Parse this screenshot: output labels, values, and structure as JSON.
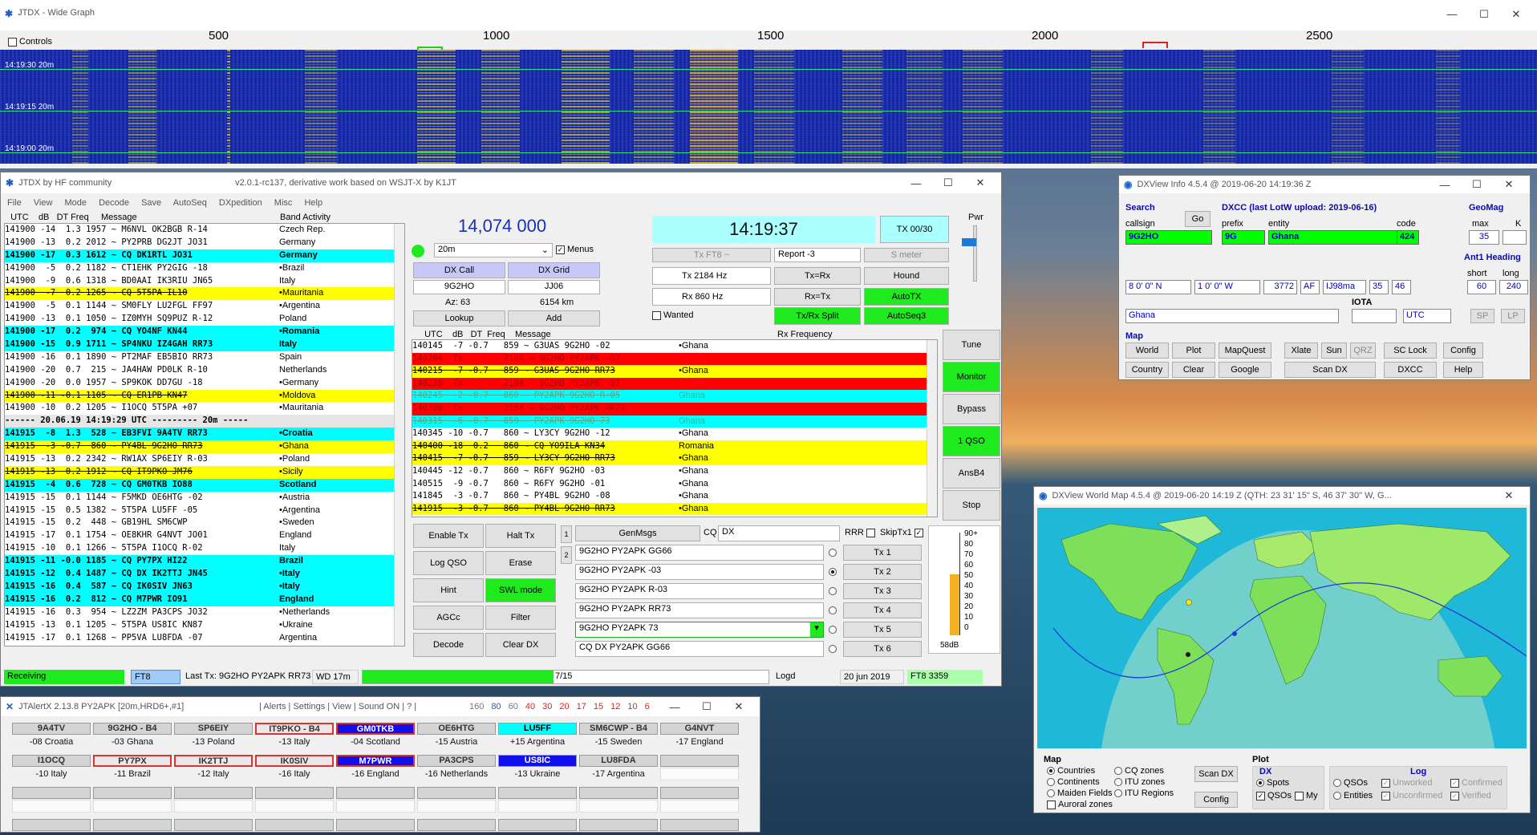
{
  "wide_graph": {
    "title": "JTDX - Wide Graph",
    "controls_label": "Controls",
    "scale_labels": [
      "500",
      "1000",
      "1500",
      "2000",
      "2500"
    ],
    "time_labels": [
      "14:19:30  20m",
      "14:19:15  20m",
      "14:19:00  20m"
    ],
    "colors": {
      "background": "#1a2fb8",
      "signal": "#ffe600",
      "timeline": "#2ee08a"
    }
  },
  "jtdx": {
    "title": "JTDX  by HF community",
    "subtitle": "v2.0.1-rc137, derivative work based on WSJT-X by K1JT",
    "menu": [
      "File",
      "View",
      "Mode",
      "Decode",
      "Save",
      "AutoSeq",
      "DXpedition",
      "Misc",
      "Help"
    ],
    "band_activity": {
      "header": "  UTC    dB   DT Freq     Message",
      "title": "Band Activity",
      "rows": [
        {
          "t": "141900 -14  1.3 1957 ~ M6NVL OK2BGB R-14",
          "c": "Czech Rep.",
          "s": ""
        },
        {
          "t": "141900 -13  0.2 2012 ~ PY2PRB DG2JT JO31",
          "c": "Germany",
          "s": ""
        },
        {
          "t": "141900 -17  0.3 1612 ~ CQ DK1RTL JO31",
          "c": "Germany",
          "s": "cq"
        },
        {
          "t": "141900  -5  0.2 1182 ~ CT1EHK PY2GIG -18",
          "c": "•Brazil",
          "s": ""
        },
        {
          "t": "141900  -9  0.6 1318 ~ BD0AAI IK3RIU JN65",
          "c": "Italy",
          "s": ""
        },
        {
          "t": "141900  -7  0.2 1265 ~ CQ 5T5PA IL10",
          "c": "•Mauritania",
          "s": "wk"
        },
        {
          "t": "141900  -5  0.1 1144 ~ SM0FLY LU2FGL FF97",
          "c": "•Argentina",
          "s": ""
        },
        {
          "t": "141900 -13  0.1 1050 ~ IZ0MYH SQ9PUZ R-12",
          "c": "Poland",
          "s": ""
        },
        {
          "t": "141900 -17  0.2  974 ~ CQ YO4NF KN44",
          "c": "•Romania",
          "s": "cq"
        },
        {
          "t": "141900 -15  0.9 1711 ~ SP4NKU IZ4GAH RR73",
          "c": "Italy",
          "s": "cq"
        },
        {
          "t": "141900 -16  0.1 1890 ~ PT2MAF EB5BIO RR73",
          "c": "Spain",
          "s": ""
        },
        {
          "t": "141900 -20  0.7  215 ~ JA4HAW PD0LK R-10",
          "c": "Netherlands",
          "s": ""
        },
        {
          "t": "141900 -20  0.0 1957 ~ SP9KOK DD7GU -18",
          "c": "•Germany",
          "s": ""
        },
        {
          "t": "141900 -11 -0.1 1105 ~ CQ ER1PB KN47",
          "c": "•Moldova",
          "s": "wk"
        },
        {
          "t": "141900 -10  0.2 1205 ~ I1OCQ 5T5PA +07",
          "c": "•Mauritania",
          "s": ""
        },
        {
          "t": "------ 20.06.19 14:19:29 UTC --------- 20m -----",
          "c": "",
          "s": "sep"
        },
        {
          "t": "141915  -8  1.3  528 ~ EB3FVI 9A4TV RR73",
          "c": "•Croatia",
          "s": "cq"
        },
        {
          "t": "141915  -3 -0.7  860 ~ PY4BL 9G2HO RR73",
          "c": "•Ghana",
          "s": "wk"
        },
        {
          "t": "141915 -13  0.2 2342 ~ RW1AX SP6EIY R-03",
          "c": "•Poland",
          "s": ""
        },
        {
          "t": "141915 -13  0.2 1912 ~ CQ IT9PKO JM76",
          "c": "•Sicily",
          "s": "wk"
        },
        {
          "t": "141915  -4  0.6  728 ~ CQ GM0TKB IO88",
          "c": "Scotland",
          "s": "cq"
        },
        {
          "t": "141915 -15  0.1 1144 ~ F5MKD OE6HTG -02",
          "c": "•Austria",
          "s": ""
        },
        {
          "t": "141915 -15  0.5 1382 ~ 5T5PA LU5FF -05",
          "c": "•Argentina",
          "s": ""
        },
        {
          "t": "141915 -15  0.2  448 ~ GB19HL SM6CWP",
          "c": "•Sweden",
          "s": ""
        },
        {
          "t": "141915 -17  0.1 1754 ~ OE8KHR G4NVT JO01",
          "c": "England",
          "s": ""
        },
        {
          "t": "141915 -10  0.1 1266 ~ 5T5PA I1OCQ R-02",
          "c": "Italy",
          "s": ""
        },
        {
          "t": "141915 -11 -0.0 1185 ~ CQ PY7PX HI22",
          "c": "Brazil",
          "s": "cq"
        },
        {
          "t": "141915 -12  0.4 1487 ~ CQ DX IK2TTJ JN45",
          "c": "•Italy",
          "s": "cq"
        },
        {
          "t": "141915 -16  0.4  587 ~ CQ IK0SIV JN63",
          "c": "•Italy",
          "s": "cq"
        },
        {
          "t": "141915 -16  0.2  812 ~ CQ M7PWR IO91",
          "c": "England",
          "s": "cq"
        },
        {
          "t": "141915 -16  0.3  954 ~ LZ2ZM PA3CPS JO32",
          "c": "•Netherlands",
          "s": ""
        },
        {
          "t": "141915 -13  0.1 1205 ~ 5T5PA US8IC KN87",
          "c": "•Ukraine",
          "s": ""
        },
        {
          "t": "141915 -17  0.1 1268 ~ PP5VA LU8FDA -07",
          "c": "Argentina",
          "s": ""
        }
      ]
    },
    "rx_frequency": {
      "header": "  UTC    dB   DT  Freq    Message",
      "title": "Rx Frequency",
      "rows": [
        {
          "t": "140145  -7 -0.7   859 ~ G3UAS 9G2HO -02",
          "c": "•Ghana",
          "s": ""
        },
        {
          "t": "140204  Tx        2184 ~ 9G2HO PY2APK -07",
          "c": "",
          "s": "tx"
        },
        {
          "t": "140215  -7 -0.7   859 ~ G3UAS 9G2HO RR73",
          "c": "•Ghana",
          "s": "wk"
        },
        {
          "t": "140230  Tx        2184 ~ 9G2HO PY2APK -07",
          "c": "",
          "s": "tx"
        },
        {
          "t": "140245  -2 -0.7   860 ~ PY2APK 9G2HO R-05",
          "c": "Ghana",
          "s": "cy"
        },
        {
          "t": "140300  Tx        2184 ~ 9G2HO PY2APK RR73",
          "c": "",
          "s": "tx"
        },
        {
          "t": "140315  -6 -0.7   859 ~ PY2APK 9G2HO 73",
          "c": "Ghana",
          "s": "cy"
        },
        {
          "t": "140345 -10 -0.7   860 ~ LY3CY 9G2HO -12",
          "c": "•Ghana",
          "s": ""
        },
        {
          "t": "140400 -18  0.2   860 ~ CQ YO9ILA KN34",
          "c": "Romania",
          "s": "wk"
        },
        {
          "t": "140415  -7 -0.7   859 ~ LY3CY 9G2HO RR73",
          "c": "•Ghana",
          "s": "wk"
        },
        {
          "t": "140445 -12 -0.7   860 ~ R6FY 9G2HO -03",
          "c": "•Ghana",
          "s": ""
        },
        {
          "t": "140515  -9 -0.7   860 ~ R6FY 9G2HO -01",
          "c": "•Ghana",
          "s": ""
        },
        {
          "t": "141845  -3 -0.7   860 ~ PY4BL 9G2HO -08",
          "c": "•Ghana",
          "s": ""
        },
        {
          "t": "141915  -3 -0.7   860 ~ PY4BL 9G2HO RR73",
          "c": "•Ghana",
          "s": "wk"
        }
      ]
    },
    "frequency": "14,074 000",
    "band": "20m",
    "menus_label": "Menus",
    "dx_call_label": "DX Call",
    "dx_grid_label": "DX Grid",
    "dx_call": "9G2HO",
    "dx_grid": "JJ06",
    "az": "Az: 63",
    "distance": "6154 km",
    "lookup": "Lookup",
    "add": "Add",
    "clock": "14:19:37",
    "tx_counter": "TX 00/30",
    "tx_mode": "Tx FT8 ~",
    "report": "Report -3",
    "s_meter": "S meter",
    "tx_freq": "Tx  2184 Hz",
    "rx_freq": "Rx  860 Hz",
    "txeqrx": "Tx=Rx",
    "rxeqtx": "Rx=Tx",
    "hound": "Hound",
    "autotx": "AutoTX",
    "txrx_split": "Tx/Rx Split",
    "autoseq3": "AutoSeq3",
    "wanted": "Wanted",
    "pwr": "Pwr",
    "side_buttons": [
      "Tune",
      "Monitor",
      "Bypass",
      "1 QSO",
      "AnsB4",
      "Stop"
    ],
    "left_buttons": [
      [
        "Enable Tx",
        "Halt Tx"
      ],
      [
        "Log QSO",
        "Erase"
      ],
      [
        "Hint",
        "SWL mode"
      ],
      [
        "AGCc",
        "Filter"
      ],
      [
        "Decode",
        "Clear DX"
      ]
    ],
    "tab_labels": [
      "1",
      "2"
    ],
    "genmsgs": "GenMsgs",
    "cq_label": "CQ",
    "cq_value": "DX",
    "rrr": "RRR",
    "skiptx1": "SkipTx1",
    "messages": [
      "9G2HO PY2APK GG66",
      "9G2HO PY2APK -03",
      "9G2HO PY2APK R-03",
      "9G2HO PY2APK RR73",
      "9G2HO PY2APK 73",
      "CQ DX PY2APK GG66"
    ],
    "tx_buttons": [
      "Tx 1",
      "Tx 2",
      "Tx 3",
      "Tx 4",
      "Tx 5",
      "Tx 6"
    ],
    "meter_labels": [
      "90+",
      "80",
      "70",
      "60",
      "50",
      "40",
      "30",
      "20",
      "10",
      "0"
    ],
    "meter_value": "58dB",
    "meter_level_db": 58,
    "status": {
      "receiving": "Receiving",
      "mode": "FT8",
      "last_tx": "Last Tx: 9G2HO PY2APK RR73",
      "wd": "WD 17m",
      "progress": "7/15",
      "progress_fraction": 0.47,
      "logd": "Logd",
      "date": "20 jun 2019",
      "ft8": "FT8  3359"
    }
  },
  "dxview_info": {
    "title": "DXView Info 4.5.4 @ 2019-06-20  14:19:36 Z",
    "search_label": "Search",
    "callsign_label": "callsign",
    "go": "Go",
    "callsign": "9G2HO",
    "dxcc_label": "DXCC  (last LotW upload: 2019-06-16)",
    "prefix_label": "prefix",
    "entity_label": "entity",
    "code_label": "code",
    "prefix": "9G",
    "entity": "Ghana",
    "code": "424",
    "geomag_label": "GeoMag",
    "max_label": "max",
    "k_label": "K",
    "max": "35",
    "lat": "8 0' 0\" N",
    "lon": "1 0' 0\" W",
    "num": "3772",
    "continent": "AF",
    "grid": "IJ98ma",
    "cq": "35",
    "itu": "46",
    "iota_label": "IOTA",
    "location": "Ghana",
    "utc": "UTC",
    "heading_label": "Ant1 Heading",
    "short_label": "short",
    "long_label": "long",
    "short": "60",
    "long": "240",
    "sp": "SP",
    "lp": "LP",
    "map_label": "Map",
    "buttons_row1": [
      "World",
      "Plot",
      "MapQuest",
      "Xlate",
      "Sun",
      "QRZ",
      "SC Lock",
      "Config"
    ],
    "buttons_row2": [
      "Country",
      "Clear",
      "Google",
      "Scan DX",
      "DXCC",
      "Help"
    ]
  },
  "jtalert": {
    "title": "JTAlertX 2.13.8 PY2APK [20m,HRD6+,#1]",
    "menu": "| Alerts | Settings | View | Sound ON | ? |",
    "levels": [
      "160",
      "80",
      "60",
      "40",
      "30",
      "20",
      "17",
      "15",
      "12",
      "10",
      "6"
    ],
    "calls": [
      {
        "call": "9A4TV",
        "info": "-08 Croatia",
        "style": ""
      },
      {
        "call": "9G2HO - B4",
        "info": "-03 Ghana",
        "style": ""
      },
      {
        "call": "SP6EIY",
        "info": "-13 Poland",
        "style": ""
      },
      {
        "call": "IT9PKO - B4",
        "info": "-13 Italy",
        "style": "red"
      },
      {
        "call": "GM0TKB",
        "info": "-04 Scotland",
        "style": "blue"
      },
      {
        "call": "OE6HTG",
        "info": "-15 Austria",
        "style": ""
      },
      {
        "call": "LU5FF",
        "info": "+15 Argentina",
        "style": "cyan"
      },
      {
        "call": "SM6CWP - B4",
        "info": "-15 Sweden",
        "style": ""
      },
      {
        "call": "G4NVT",
        "info": "-17 England",
        "style": ""
      },
      {
        "call": "I1OCQ",
        "info": "-10 Italy",
        "style": ""
      },
      {
        "call": "PY7PX",
        "info": "-11 Brazil",
        "style": "red"
      },
      {
        "call": "IK2TTJ",
        "info": "-12 Italy",
        "style": "red"
      },
      {
        "call": "IK0SIV",
        "info": "-16 Italy",
        "style": "red"
      },
      {
        "call": "M7PWR",
        "info": "-16 England",
        "style": "blue"
      },
      {
        "call": "PA3CPS",
        "info": "-16 Netherlands",
        "style": ""
      },
      {
        "call": "US8IC",
        "info": "-13 Ukraine",
        "style": "bluewhite"
      },
      {
        "call": "LU8FDA",
        "info": "-17 Argentina",
        "style": ""
      }
    ]
  },
  "world_map": {
    "title": "DXView World Map 4.5.4 @ 2019-06-20  14:19 Z  (QTH: 23 31' 15\" S, 46 37' 30\" W, G...",
    "map_label": "Map",
    "map_options": [
      "Countries",
      "Continents",
      "Maiden Fields",
      "Auroral zones"
    ],
    "zone_options": [
      "CQ zones",
      "ITU zones",
      "ITU Regions"
    ],
    "scan_dx": "Scan DX",
    "config": "Config",
    "plot_label": "Plot",
    "dx_label": "DX",
    "spots": "Spots",
    "qsos": "QSOs",
    "my": "My",
    "log_label": "Log",
    "log_qsos": "QSOs",
    "entities": "Entities",
    "unworked": "Unworked",
    "unconfirmed": "Unconfirmed",
    "confirmed": "Confirmed",
    "verified": "Verified",
    "colors": {
      "ocean": "#1fb8d8",
      "night": "#8fd8c8",
      "land": "#7ee05a",
      "path": "#1e3cd0"
    }
  }
}
